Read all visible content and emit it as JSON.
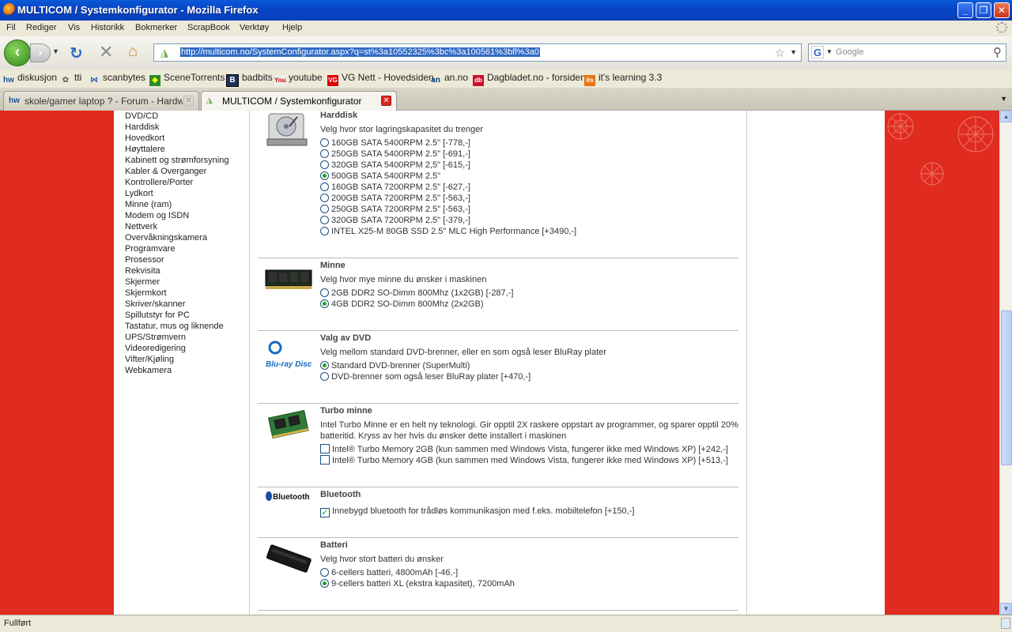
{
  "window": {
    "title": "MULTICOM / Systemkonfigurator - Mozilla Firefox"
  },
  "menu": [
    "Fil",
    "Rediger",
    "Vis",
    "Historikk",
    "Bokmerker",
    "ScrapBook",
    "Verktøy",
    "Hjelp"
  ],
  "nav": {
    "url": "http://multicom.no/SystemConfigurator.aspx?q=st%3a10552325%3bc%3a100561%3bfl%3a0",
    "search_placeholder": "Google"
  },
  "bookmarks": [
    {
      "label": "diskusjon",
      "icon": "hw"
    },
    {
      "label": "tti",
      "icon": "tt"
    },
    {
      "label": "scanbytes",
      "icon": "sb"
    },
    {
      "label": "SceneTorrents",
      "icon": "st"
    },
    {
      "label": "badbits",
      "icon": "B"
    },
    {
      "label": "youtube",
      "icon": "Y"
    },
    {
      "label": "VG Nett - Hovedsiden",
      "icon": "VG"
    },
    {
      "label": "an.no",
      "icon": "an"
    },
    {
      "label": "Dagbladet.no - forsiden",
      "icon": "db"
    },
    {
      "label": "it's learning 3.3",
      "icon": "its"
    }
  ],
  "tabs": [
    {
      "label": "skole/gamer laptop ? - Forum - Hardwa...",
      "active": false
    },
    {
      "label": "MULTICOM / Systemkonfigurator",
      "active": true
    }
  ],
  "sidebar": [
    "DVD/CD",
    "Harddisk",
    "Hovedkort",
    "Høyttalere",
    "Kabinett og strømforsyning",
    "Kabler & Overganger",
    "Kontrollere/Porter",
    "Lydkort",
    "Minne (ram)",
    "Modem og ISDN",
    "Nettverk",
    "Overvåkningskamera",
    "Programvare",
    "Prosessor",
    "Rekvisita",
    "Skjermer",
    "Skjermkort",
    "Skriver/skanner",
    "Spillutstyr for PC",
    "Tastatur, mus og liknende",
    "UPS/Strømvern",
    "Videoredigering",
    "Vifter/Kjøling",
    "Webkamera"
  ],
  "sections": {
    "harddisk": {
      "title": "Harddisk",
      "desc": "Velg hvor stor lagringskapasitet du trenger",
      "options": [
        {
          "label": "160GB SATA 5400RPM 2.5\" [-778,-]",
          "selected": false
        },
        {
          "label": "250GB SATA 5400RPM 2.5\" [-691,-]",
          "selected": false
        },
        {
          "label": "320GB SATA 5400RPM 2,5\" [-615,-]",
          "selected": false
        },
        {
          "label": "500GB SATA 5400RPM 2.5\"",
          "selected": true
        },
        {
          "label": "160GB SATA 7200RPM 2.5\" [-627,-]",
          "selected": false
        },
        {
          "label": "200GB SATA 7200RPM 2.5\" [-563,-]",
          "selected": false
        },
        {
          "label": "250GB SATA 7200RPM 2.5\" [-563,-]",
          "selected": false
        },
        {
          "label": "320GB SATA 7200RPM 2.5\" [-379,-]",
          "selected": false
        },
        {
          "label": "INTEL X25-M 80GB SSD 2.5\" MLC High Performance [+3490,-]",
          "selected": false
        }
      ]
    },
    "minne": {
      "title": "Minne",
      "desc": "Velg hvor mye minne du ønsker i maskinen",
      "options": [
        {
          "label": "2GB DDR2 SO-Dimm 800Mhz (1x2GB) [-287,-]",
          "selected": false
        },
        {
          "label": "4GB DDR2 SO-Dimm 800Mhz (2x2GB)",
          "selected": true
        }
      ]
    },
    "dvd": {
      "title": "Valg av DVD",
      "desc": "Velg mellom standard DVD-brenner, eller en som også leser BluRay plater",
      "logo_text": "Blu-ray Disc",
      "options": [
        {
          "label": "Standard DVD-brenner (SuperMulti)",
          "selected": true
        },
        {
          "label": "DVD-brenner som også leser BluRay plater [+470,-]",
          "selected": false
        }
      ]
    },
    "turbo": {
      "title": "Turbo minne",
      "desc": "Intel Turbo Minne er en helt ny teknologi. Gir opptil 2X raskere oppstart av programmer, og sparer opptil 20% batteritid. Kryss av her hvis du ønsker dette installert i maskinen",
      "options": [
        {
          "label": "Intel® Turbo Memory 2GB (kun sammen med Windows Vista, fungerer ikke med Windows XP) [+242,-]",
          "checked": false
        },
        {
          "label": "Intel® Turbo Memory 4GB (kun sammen med Windows Vista, fungerer ikke med Windows XP) [+513,-]",
          "checked": false
        }
      ]
    },
    "bluetooth": {
      "title": "Bluetooth",
      "logo_text": "Bluetooth",
      "options": [
        {
          "label": "Innebygd bluetooth for trådløs kommunikasjon med f.eks. mobiltelefon [+150,-]",
          "checked": true
        }
      ]
    },
    "batteri": {
      "title": "Batteri",
      "desc": "Velg hvor stort batteri du ønsker",
      "options": [
        {
          "label": "6-cellers batteri, 4800mAh [-46,-]",
          "selected": false
        },
        {
          "label": "9-cellers batteri XL (ekstra kapasitet), 7200mAh",
          "selected": true
        }
      ]
    }
  },
  "status": "Fullført",
  "colors": {
    "page_bg": "#e02b20",
    "titlebar": "#0a5ad8",
    "radio_selected": "#21a121"
  }
}
